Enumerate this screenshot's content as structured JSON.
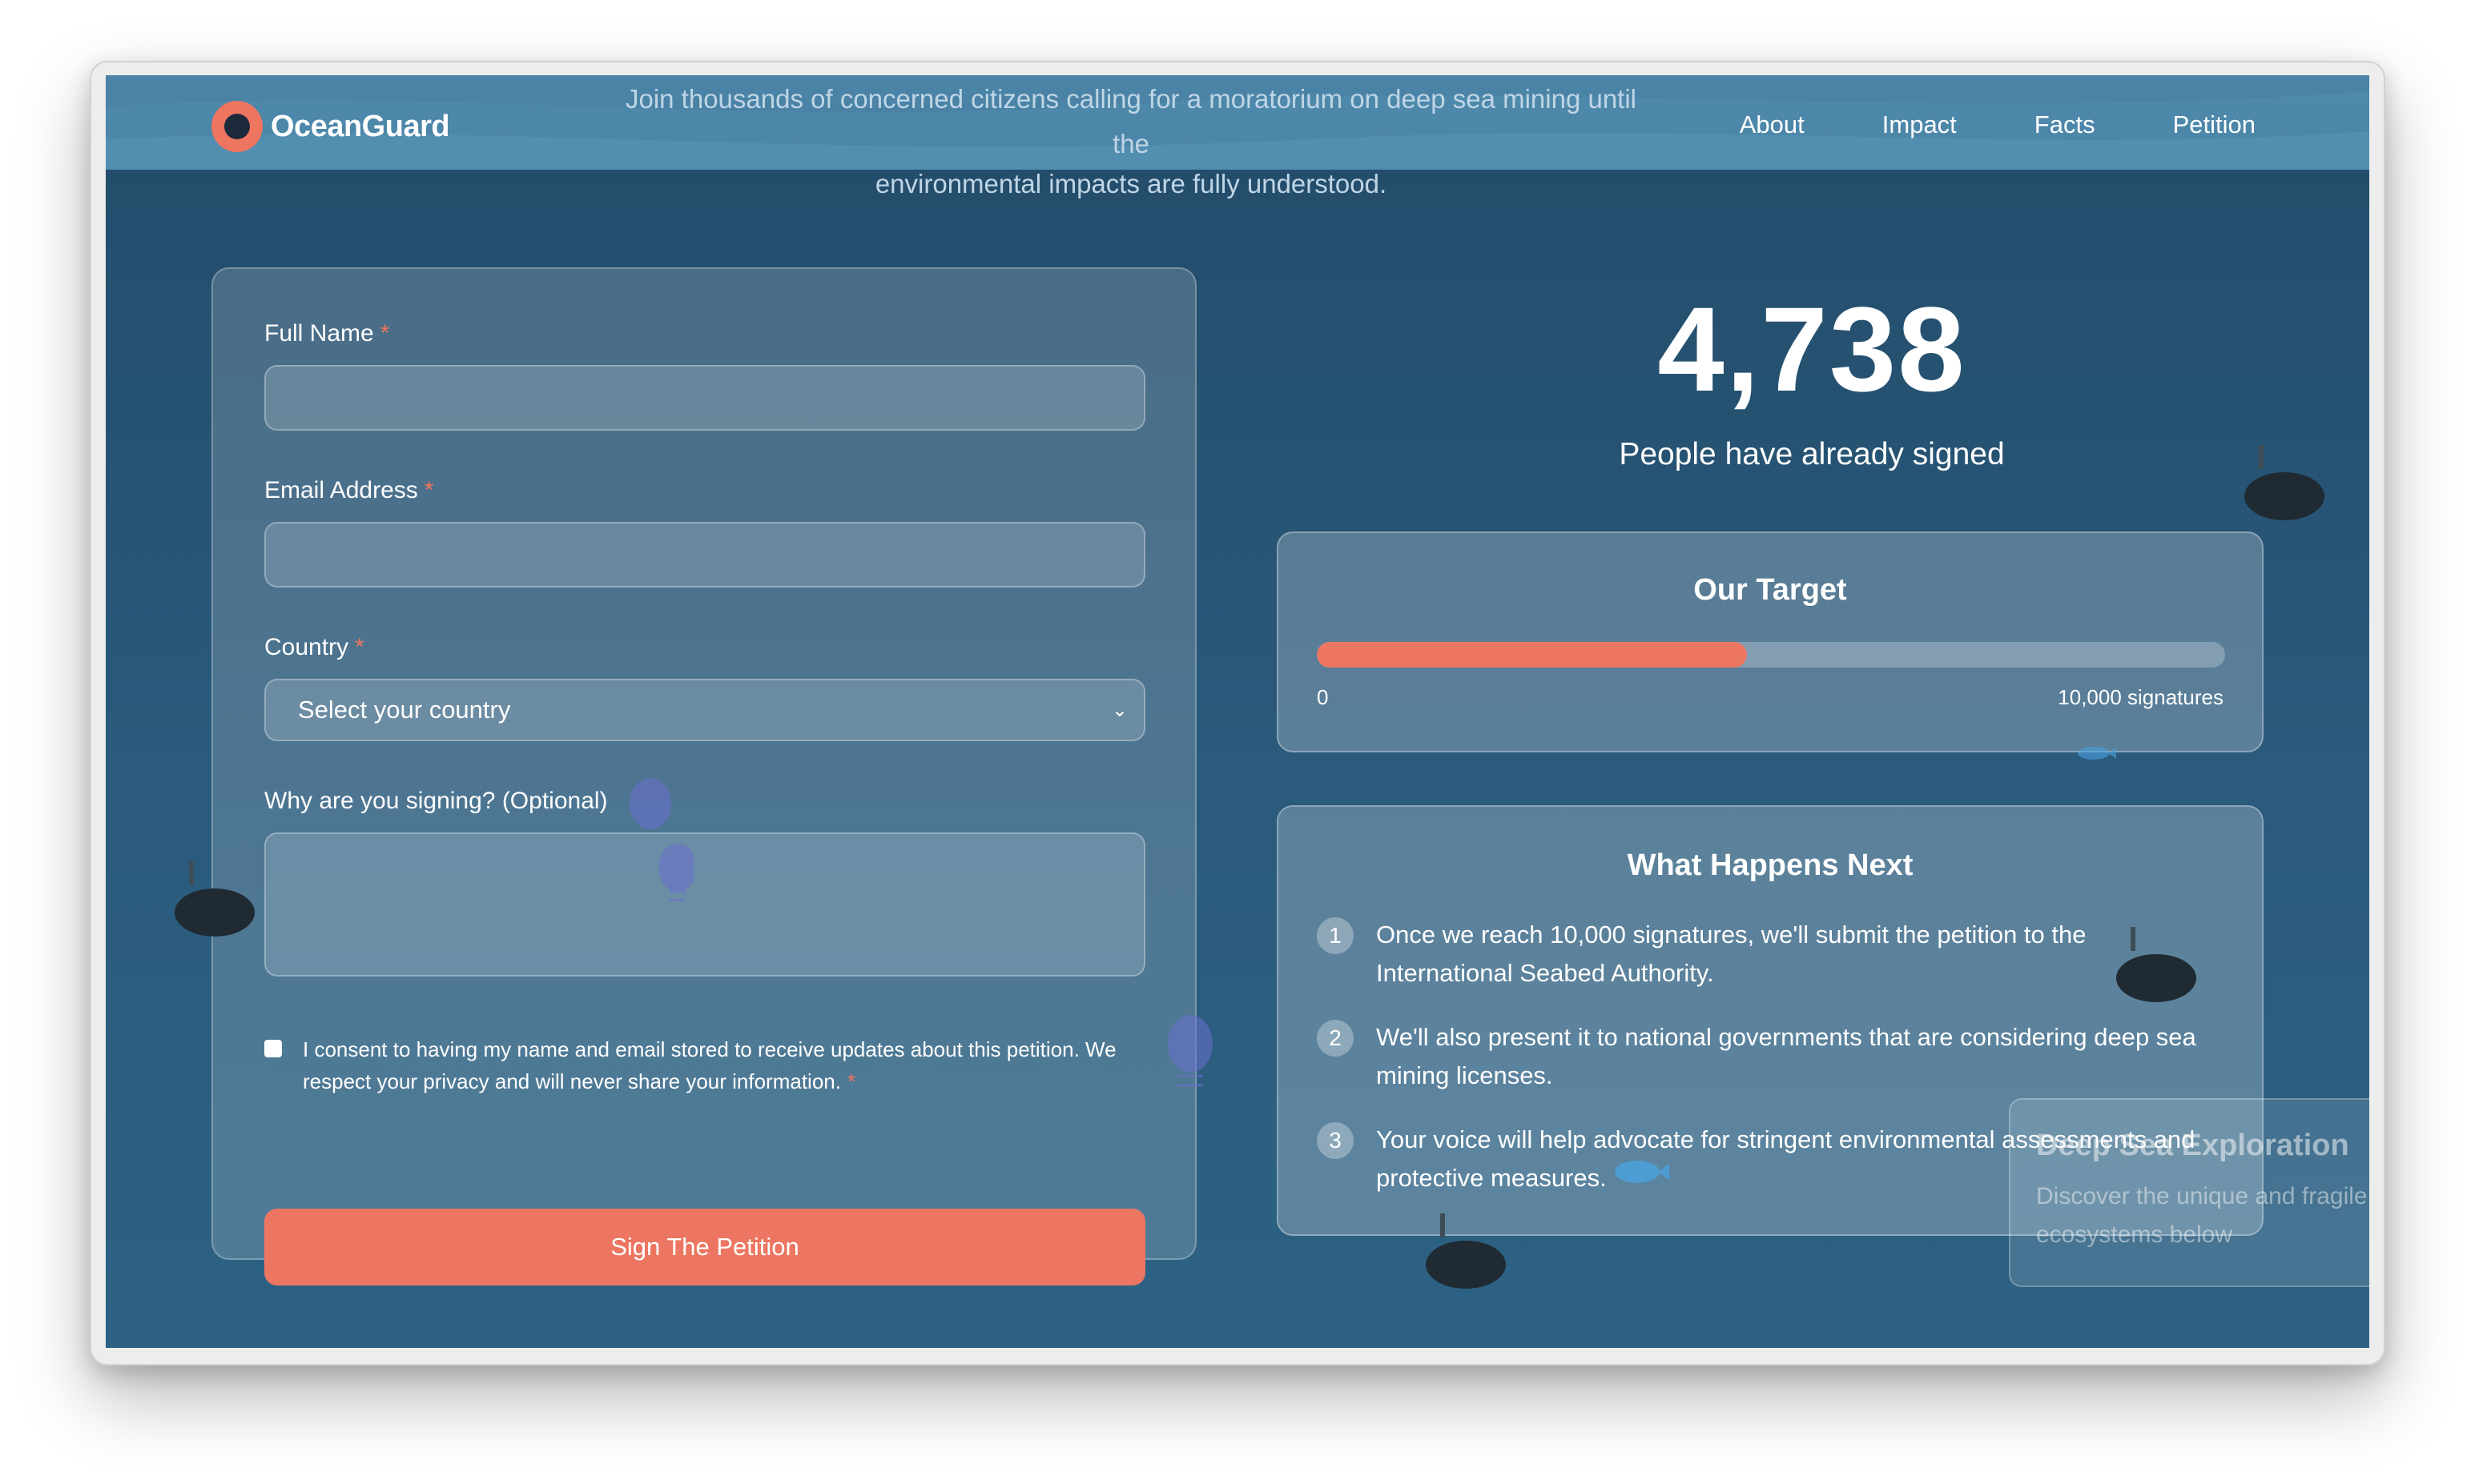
{
  "header": {
    "logo_text": "OceanGuard",
    "tagline_line1": "Join thousands of concerned citizens calling for a moratorium on deep sea mining until the",
    "tagline_line2": "environmental impacts are fully understood.",
    "nav": [
      "About",
      "Impact",
      "Facts",
      "Petition"
    ]
  },
  "form": {
    "full_name_label": "Full Name",
    "full_name_value": "",
    "email_label": "Email Address",
    "email_value": "",
    "country_label": "Country",
    "country_selected": "Select your country",
    "reason_label": "Why are you signing? (Optional)",
    "reason_value": "",
    "required_marker": "*",
    "consent_text": "I consent to having my name and email stored to receive updates about this petition. We respect your privacy and will never share your information.",
    "consent_checked": false,
    "submit_label": "Sign The Petition"
  },
  "stats": {
    "signature_count": "4,738",
    "signature_label": "People have already signed"
  },
  "target": {
    "title": "Our Target",
    "progress_fraction": 0.4738,
    "min_label": "0",
    "max_label": "10,000 signatures"
  },
  "next_steps": {
    "title": "What Happens Next",
    "steps": [
      {
        "num": "1",
        "text": "Once we reach 10,000 signatures, we'll submit the petition to the International Seabed Authority."
      },
      {
        "num": "2",
        "text": "We'll also present it to national governments that are considering deep sea mining licenses."
      },
      {
        "num": "3",
        "text": "Your voice will help advocate for stringent environmental assessments and protective measures."
      }
    ]
  },
  "explore": {
    "title": "Deep Sea Exploration",
    "description": "Discover the unique and fragile ecosystems below"
  },
  "colors": {
    "accent": "#ec7661",
    "background_top": "#234b69",
    "background_bottom": "#2d6284",
    "header": "#4f8bad"
  }
}
